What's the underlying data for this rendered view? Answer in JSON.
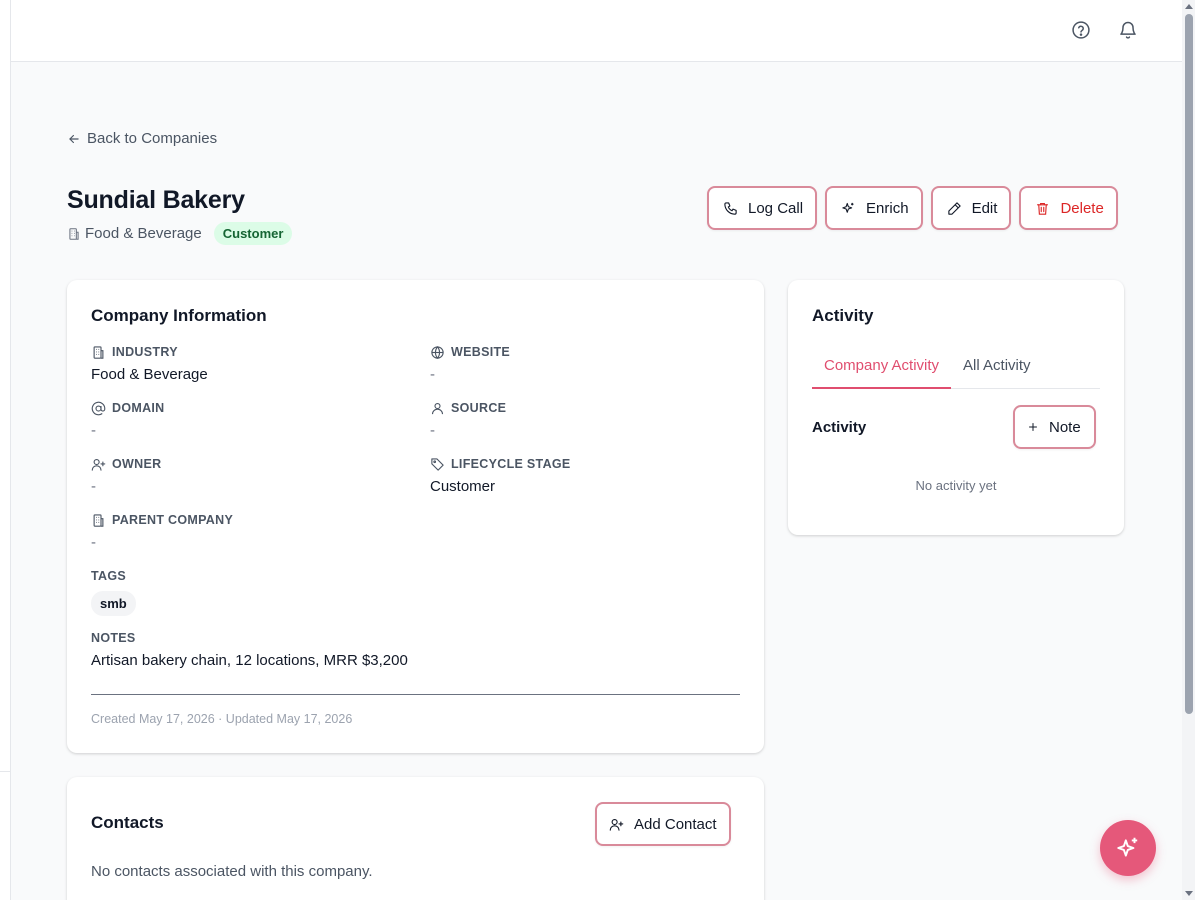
{
  "nav": {
    "back_label": "Back to Companies"
  },
  "company": {
    "name": "Sundial Bakery",
    "industry": "Food & Beverage",
    "lifecycle_badge": "Customer"
  },
  "actions": {
    "log_call": "Log Call",
    "enrich": "Enrich",
    "edit": "Edit",
    "delete": "Delete"
  },
  "info": {
    "title": "Company Information",
    "fields": {
      "industry": {
        "label": "INDUSTRY",
        "value": "Food & Beverage"
      },
      "website": {
        "label": "WEBSITE",
        "value": "-"
      },
      "domain": {
        "label": "DOMAIN",
        "value": "-"
      },
      "source": {
        "label": "SOURCE",
        "value": "-"
      },
      "owner": {
        "label": "OWNER",
        "value": "-"
      },
      "lifecycle": {
        "label": "LIFECYCLE STAGE",
        "value": "Customer"
      },
      "parent": {
        "label": "PARENT COMPANY",
        "value": "-"
      }
    },
    "tags_label": "TAGS",
    "tags": [
      "smb"
    ],
    "notes_label": "NOTES",
    "notes": "Artisan bakery chain, 12 locations, MRR $3,200",
    "meta": "Created May 17, 2026 · Updated May 17, 2026"
  },
  "activity": {
    "title": "Activity",
    "tabs": [
      "Company Activity",
      "All Activity"
    ],
    "section_label": "Activity",
    "note_button": "Note",
    "empty": "No activity yet"
  },
  "contacts": {
    "title": "Contacts",
    "add_button": "Add Contact",
    "empty": "No contacts associated with this company."
  },
  "colors": {
    "accent": "#e04e6f",
    "button_border": "#d98a9a",
    "badge_bg": "#dcfce7",
    "badge_text": "#166534",
    "danger": "#dc2626"
  }
}
